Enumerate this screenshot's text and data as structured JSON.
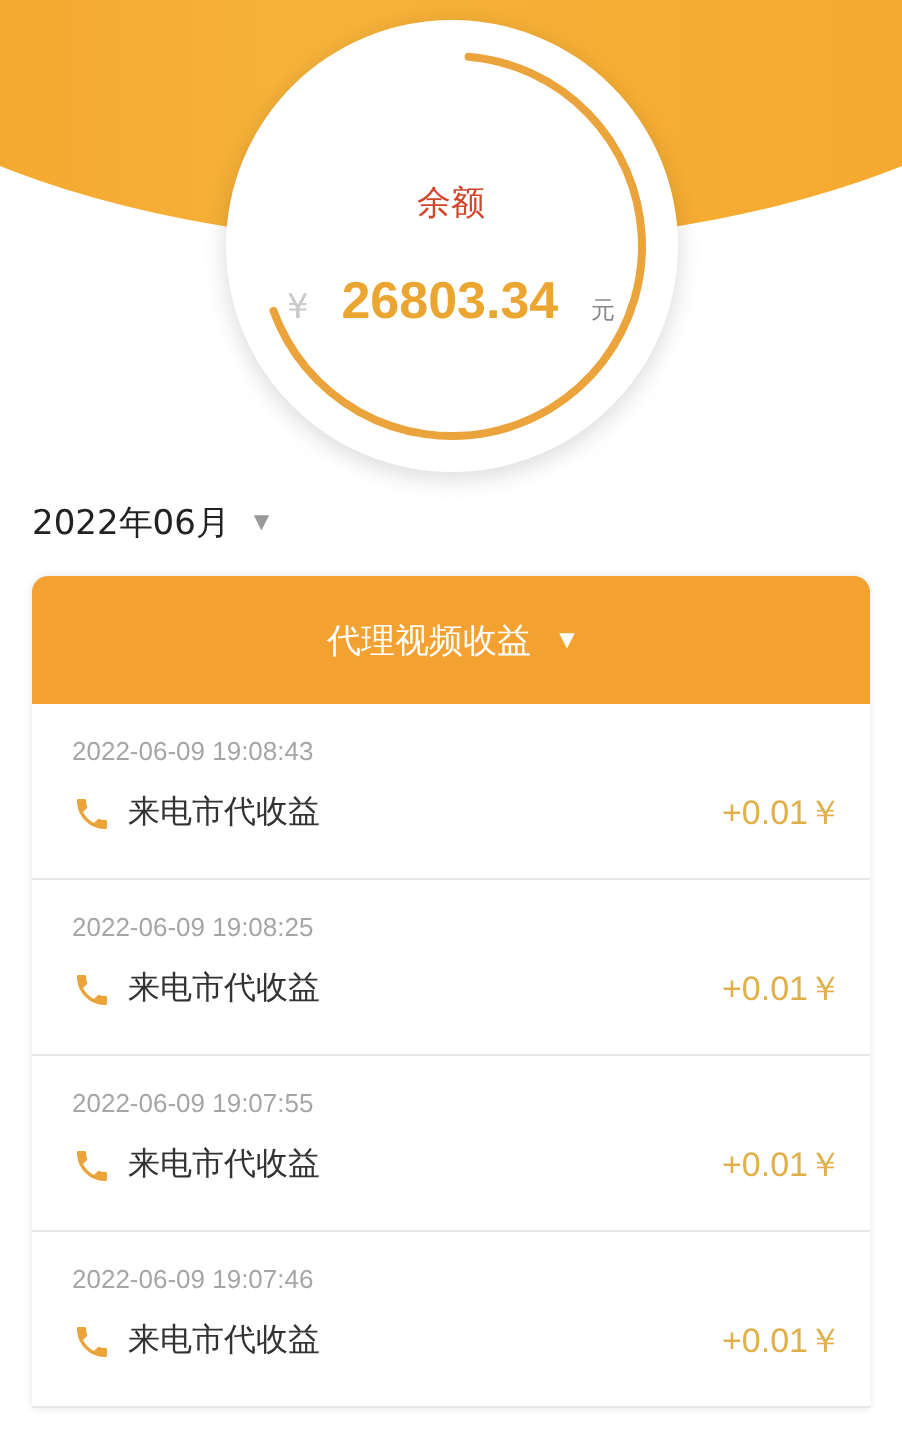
{
  "balance": {
    "label": "余额",
    "currency_symbol": "¥",
    "amount": "26803.34",
    "unit": "元"
  },
  "month_picker": {
    "value": "2022年06月",
    "caret": "▼"
  },
  "category": {
    "title": "代理视频收益",
    "caret": "▼"
  },
  "records": [
    {
      "time": "2022-06-09 19:08:43",
      "title": "来电市代收益",
      "amount": "+0.01￥"
    },
    {
      "time": "2022-06-09 19:08:25",
      "title": "来电市代收益",
      "amount": "+0.01￥"
    },
    {
      "time": "2022-06-09 19:07:55",
      "title": "来电市代收益",
      "amount": "+0.01￥"
    },
    {
      "time": "2022-06-09 19:07:46",
      "title": "来电市代收益",
      "amount": "+0.01￥"
    }
  ]
}
